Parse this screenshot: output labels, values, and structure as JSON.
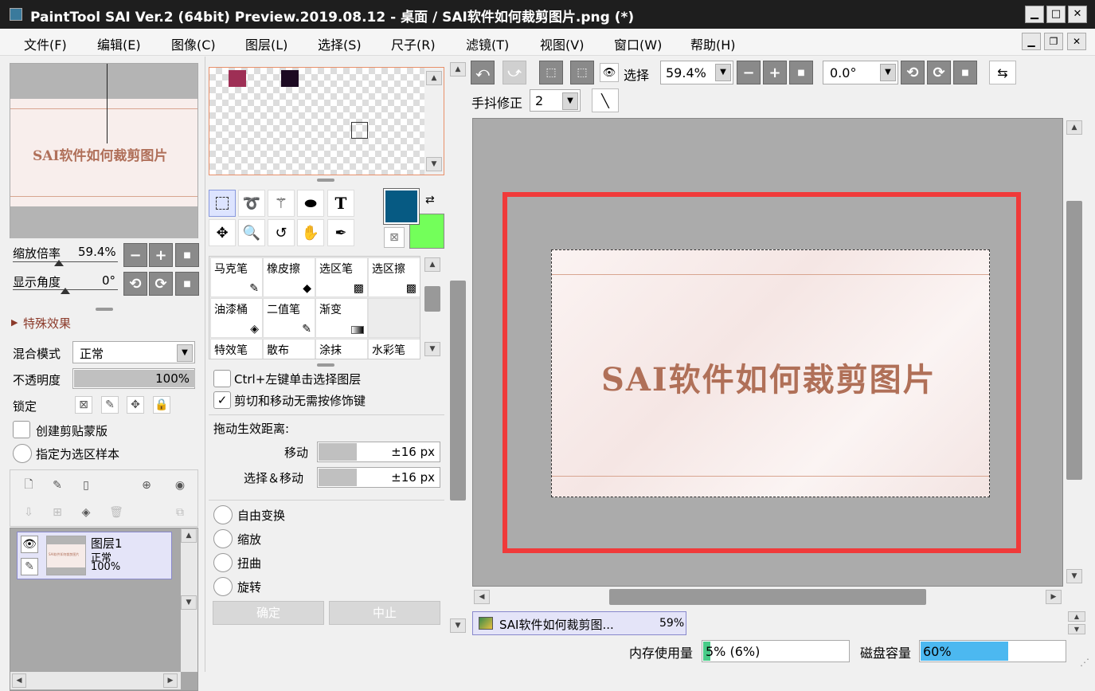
{
  "window": {
    "title": "PaintTool SAI Ver.2 (64bit) Preview.2019.08.12 - 桌面 / SAI软件如何裁剪图片.png (*)",
    "min": "▁",
    "max": "□",
    "close": "✕"
  },
  "menu": [
    "文件(F)",
    "编辑(E)",
    "图像(C)",
    "图层(L)",
    "选择(S)",
    "尺子(R)",
    "滤镜(T)",
    "视图(V)",
    "窗口(W)",
    "帮助(H)"
  ],
  "navigator": {
    "image_text": "SAI软件如何裁剪图片",
    "zoom_label": "缩放倍率",
    "zoom_value": "59.4%",
    "angle_label": "显示角度",
    "angle_value": "0°"
  },
  "layer_props": {
    "special_effects": "特殊效果",
    "blend_label": "混合模式",
    "blend_value": "正常",
    "opacity_label": "不透明度",
    "opacity_value": "100%",
    "opacity_fraction": 1.0,
    "lock_label": "锁定",
    "clip_label": "创建剪贴蒙版",
    "sample_label": "指定为选区样本"
  },
  "layer": {
    "name": "图层1",
    "mode": "正常",
    "opacity": "100%",
    "thumb_text": "SAI软件如何裁剪图片"
  },
  "colors": {
    "primary": "#065a83",
    "secondary": "#73ff5a",
    "swatch1": "#9e2f55",
    "swatch2": "#1c0a22"
  },
  "tools": {
    "text_tool": "T"
  },
  "brushes": [
    "马克笔",
    "橡皮擦",
    "选区笔",
    "选区擦",
    "油漆桶",
    "二值笔",
    "渐变",
    "",
    "特效笔",
    "散布",
    "涂抹",
    "水彩笔"
  ],
  "tool_options": {
    "ctrl_click": "Ctrl+左键单击选择图层",
    "no_modifier": "剪切和移动无需按修饰键",
    "drag_label": "拖动生效距离:",
    "move_label": "移动",
    "move_value": "±16 px",
    "selmove_label": "选择＆移动",
    "selmove_value": "±16 px",
    "free_transform": "自由变换",
    "scale": "缩放",
    "distort": "扭曲",
    "rotate": "旋转",
    "ok": "确定",
    "cancel": "中止"
  },
  "toolbar": {
    "select_label": "选择",
    "zoom_value": "59.4%",
    "angle_value": "0.0°",
    "stabilizer_label": "手抖修正",
    "stabilizer_value": "2"
  },
  "canvas": {
    "image_text": "SAI软件如何裁剪图片",
    "highlight_color": "#f03a3a"
  },
  "doc_tab": {
    "name": "SAI软件如何裁剪图...",
    "zoom": "59%"
  },
  "status": {
    "mem_label": "内存使用量",
    "mem_value": "5% (6%)",
    "mem_fraction": 0.05,
    "disk_label": "磁盘容量",
    "disk_value": "60%",
    "disk_fraction": 0.6
  }
}
